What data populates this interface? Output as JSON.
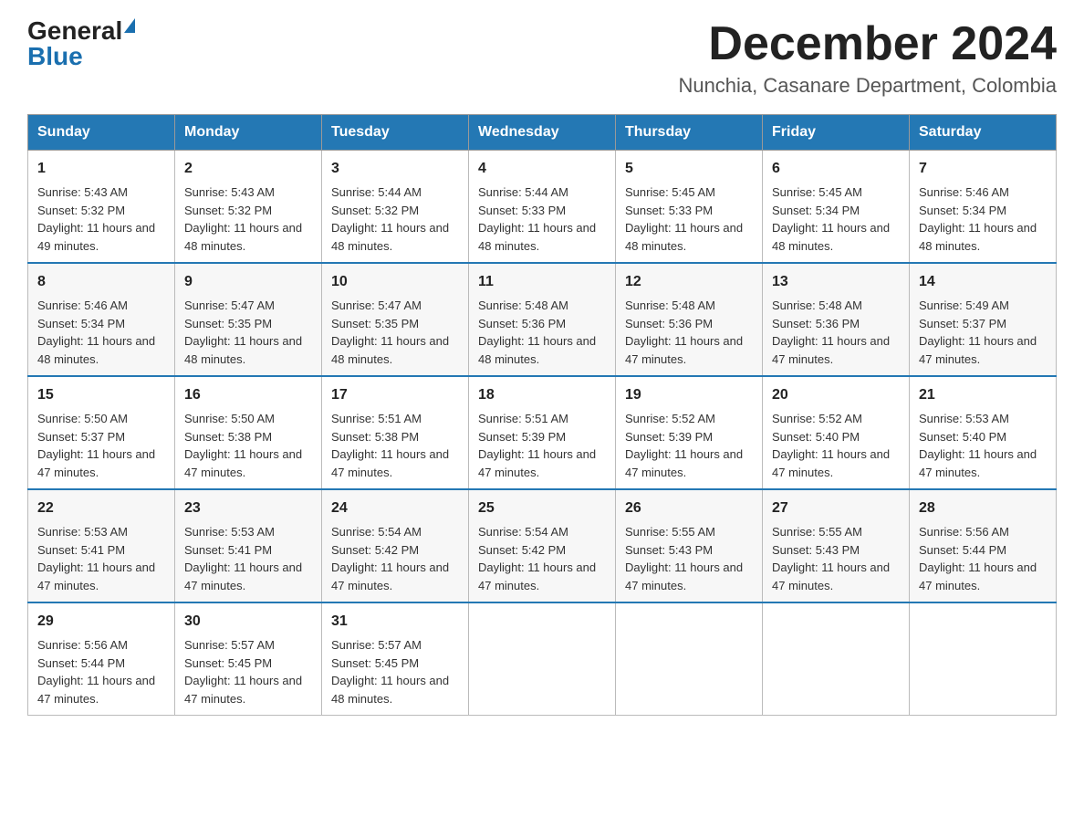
{
  "header": {
    "logo_general": "General",
    "logo_blue": "Blue",
    "month_title": "December 2024",
    "location": "Nunchia, Casanare Department, Colombia"
  },
  "weekdays": [
    "Sunday",
    "Monday",
    "Tuesday",
    "Wednesday",
    "Thursday",
    "Friday",
    "Saturday"
  ],
  "weeks": [
    [
      {
        "day": "1",
        "sunrise": "5:43 AM",
        "sunset": "5:32 PM",
        "daylight": "11 hours and 49 minutes."
      },
      {
        "day": "2",
        "sunrise": "5:43 AM",
        "sunset": "5:32 PM",
        "daylight": "11 hours and 48 minutes."
      },
      {
        "day": "3",
        "sunrise": "5:44 AM",
        "sunset": "5:32 PM",
        "daylight": "11 hours and 48 minutes."
      },
      {
        "day": "4",
        "sunrise": "5:44 AM",
        "sunset": "5:33 PM",
        "daylight": "11 hours and 48 minutes."
      },
      {
        "day": "5",
        "sunrise": "5:45 AM",
        "sunset": "5:33 PM",
        "daylight": "11 hours and 48 minutes."
      },
      {
        "day": "6",
        "sunrise": "5:45 AM",
        "sunset": "5:34 PM",
        "daylight": "11 hours and 48 minutes."
      },
      {
        "day": "7",
        "sunrise": "5:46 AM",
        "sunset": "5:34 PM",
        "daylight": "11 hours and 48 minutes."
      }
    ],
    [
      {
        "day": "8",
        "sunrise": "5:46 AM",
        "sunset": "5:34 PM",
        "daylight": "11 hours and 48 minutes."
      },
      {
        "day": "9",
        "sunrise": "5:47 AM",
        "sunset": "5:35 PM",
        "daylight": "11 hours and 48 minutes."
      },
      {
        "day": "10",
        "sunrise": "5:47 AM",
        "sunset": "5:35 PM",
        "daylight": "11 hours and 48 minutes."
      },
      {
        "day": "11",
        "sunrise": "5:48 AM",
        "sunset": "5:36 PM",
        "daylight": "11 hours and 48 minutes."
      },
      {
        "day": "12",
        "sunrise": "5:48 AM",
        "sunset": "5:36 PM",
        "daylight": "11 hours and 47 minutes."
      },
      {
        "day": "13",
        "sunrise": "5:48 AM",
        "sunset": "5:36 PM",
        "daylight": "11 hours and 47 minutes."
      },
      {
        "day": "14",
        "sunrise": "5:49 AM",
        "sunset": "5:37 PM",
        "daylight": "11 hours and 47 minutes."
      }
    ],
    [
      {
        "day": "15",
        "sunrise": "5:50 AM",
        "sunset": "5:37 PM",
        "daylight": "11 hours and 47 minutes."
      },
      {
        "day": "16",
        "sunrise": "5:50 AM",
        "sunset": "5:38 PM",
        "daylight": "11 hours and 47 minutes."
      },
      {
        "day": "17",
        "sunrise": "5:51 AM",
        "sunset": "5:38 PM",
        "daylight": "11 hours and 47 minutes."
      },
      {
        "day": "18",
        "sunrise": "5:51 AM",
        "sunset": "5:39 PM",
        "daylight": "11 hours and 47 minutes."
      },
      {
        "day": "19",
        "sunrise": "5:52 AM",
        "sunset": "5:39 PM",
        "daylight": "11 hours and 47 minutes."
      },
      {
        "day": "20",
        "sunrise": "5:52 AM",
        "sunset": "5:40 PM",
        "daylight": "11 hours and 47 minutes."
      },
      {
        "day": "21",
        "sunrise": "5:53 AM",
        "sunset": "5:40 PM",
        "daylight": "11 hours and 47 minutes."
      }
    ],
    [
      {
        "day": "22",
        "sunrise": "5:53 AM",
        "sunset": "5:41 PM",
        "daylight": "11 hours and 47 minutes."
      },
      {
        "day": "23",
        "sunrise": "5:53 AM",
        "sunset": "5:41 PM",
        "daylight": "11 hours and 47 minutes."
      },
      {
        "day": "24",
        "sunrise": "5:54 AM",
        "sunset": "5:42 PM",
        "daylight": "11 hours and 47 minutes."
      },
      {
        "day": "25",
        "sunrise": "5:54 AM",
        "sunset": "5:42 PM",
        "daylight": "11 hours and 47 minutes."
      },
      {
        "day": "26",
        "sunrise": "5:55 AM",
        "sunset": "5:43 PM",
        "daylight": "11 hours and 47 minutes."
      },
      {
        "day": "27",
        "sunrise": "5:55 AM",
        "sunset": "5:43 PM",
        "daylight": "11 hours and 47 minutes."
      },
      {
        "day": "28",
        "sunrise": "5:56 AM",
        "sunset": "5:44 PM",
        "daylight": "11 hours and 47 minutes."
      }
    ],
    [
      {
        "day": "29",
        "sunrise": "5:56 AM",
        "sunset": "5:44 PM",
        "daylight": "11 hours and 47 minutes."
      },
      {
        "day": "30",
        "sunrise": "5:57 AM",
        "sunset": "5:45 PM",
        "daylight": "11 hours and 47 minutes."
      },
      {
        "day": "31",
        "sunrise": "5:57 AM",
        "sunset": "5:45 PM",
        "daylight": "11 hours and 48 minutes."
      },
      null,
      null,
      null,
      null
    ]
  ]
}
